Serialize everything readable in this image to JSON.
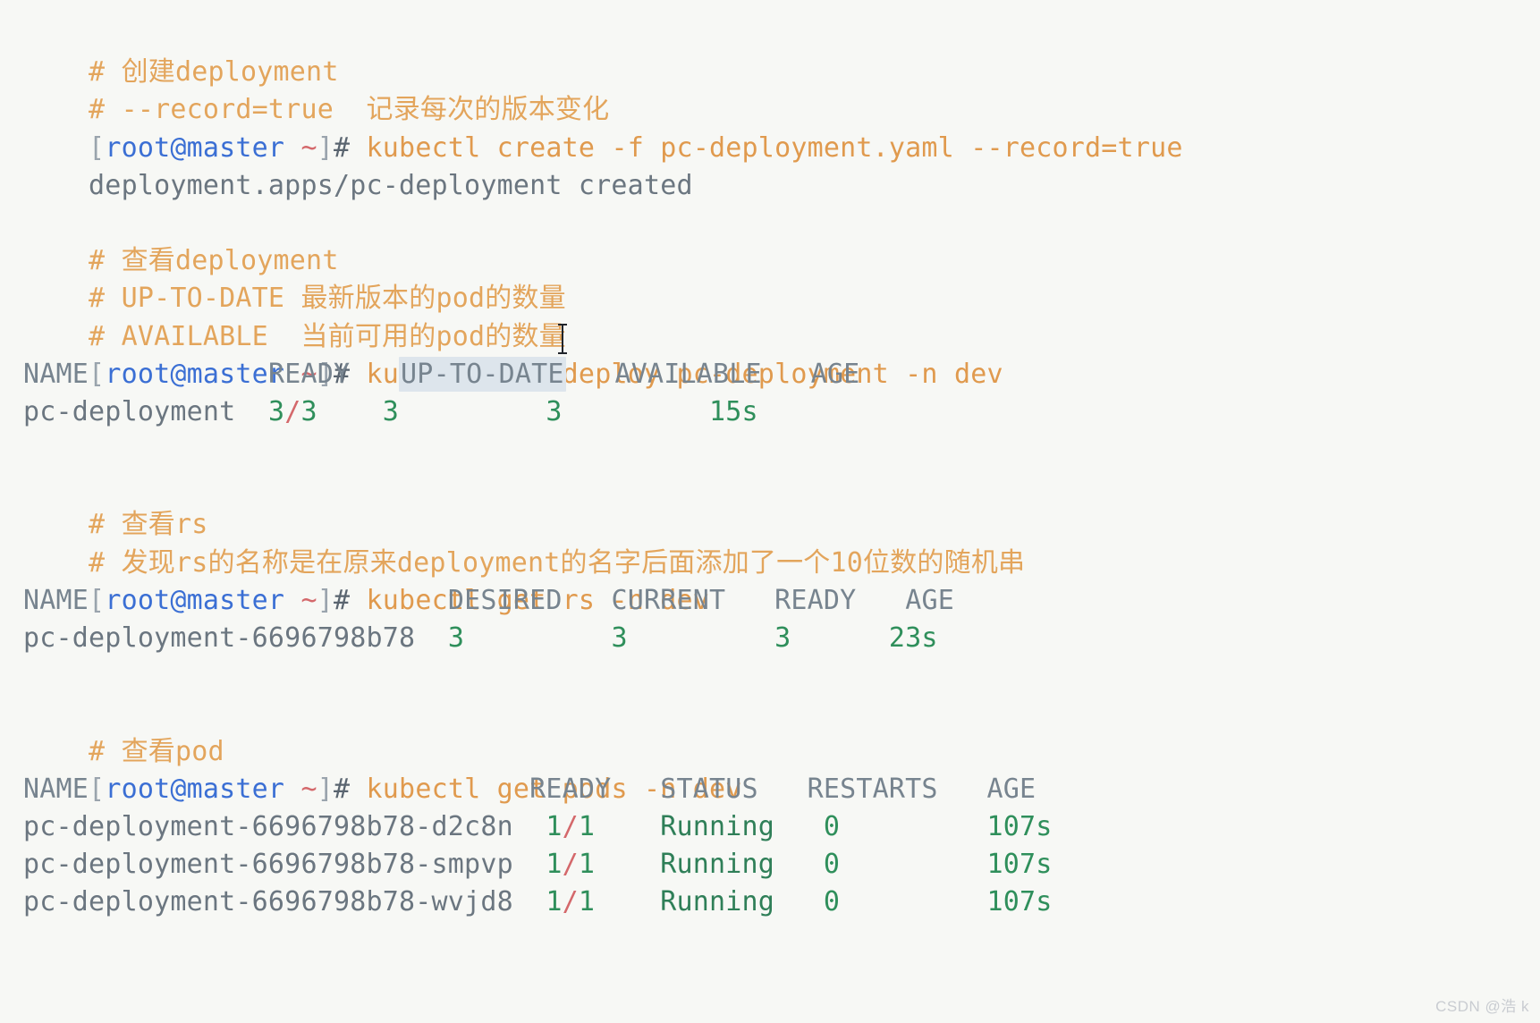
{
  "terminal": {
    "background_color": "#f7f8f5",
    "colors": {
      "comment": "#e3a55c",
      "command": "#e09a4e",
      "output": "#6b7680",
      "header": "#77848f",
      "number": "#2f8f5b",
      "prompt_user": "#3b6fd4",
      "prompt_tilde": "#d4686b",
      "highlight": "#dde5ec"
    },
    "prompt": {
      "open_bracket": "[",
      "user_host": "root@master",
      "space_tilde": " ~",
      "close_bracket": "]",
      "hash": "# "
    },
    "blocks": [
      {
        "id": "create-deployment",
        "comments": [
          "# 创建deployment",
          "# --record=true  记录每次的版本变化"
        ],
        "command": "kubectl create -f pc-deployment.yaml --record=true",
        "output": [
          "deployment.apps/pc-deployment created"
        ]
      },
      {
        "id": "get-deployment",
        "comments": [
          "# 查看deployment",
          "# UP-TO-DATE 最新版本的pod的数量",
          "# AVAILABLE  当前可用的pod的数量"
        ],
        "command": "kubectl get deploy pc-deployment -n dev",
        "table": {
          "headers": [
            "NAME",
            "READY",
            "UP-TO-DATE",
            "AVAILABLE",
            "AGE"
          ],
          "highlighted_header": "UP-TO-DATE",
          "rows": [
            {
              "name": "pc-deployment",
              "ready": "3/3",
              "up_to_date": "3",
              "available": "3",
              "age": "15s"
            }
          ]
        }
      },
      {
        "id": "get-rs",
        "comments": [
          "# 查看rs",
          "# 发现rs的名称是在原来deployment的名字后面添加了一个10位数的随机串"
        ],
        "command": "kubectl get rs -n dev",
        "table": {
          "headers": [
            "NAME",
            "DESIRED",
            "CURRENT",
            "READY",
            "AGE"
          ],
          "rows": [
            {
              "name": "pc-deployment-6696798b78",
              "desired": "3",
              "current": "3",
              "ready": "3",
              "age": "23s"
            }
          ]
        }
      },
      {
        "id": "get-pods",
        "comments": [
          "# 查看pod"
        ],
        "command": "kubectl get pods -n dev",
        "table": {
          "headers": [
            "NAME",
            "READY",
            "STATUS",
            "RESTARTS",
            "AGE"
          ],
          "rows": [
            {
              "name": "pc-deployment-6696798b78-d2c8n",
              "ready": "1/1",
              "status": "Running",
              "restarts": "0",
              "age": "107s"
            },
            {
              "name": "pc-deployment-6696798b78-smpvp",
              "ready": "1/1",
              "status": "Running",
              "restarts": "0",
              "age": "107s"
            },
            {
              "name": "pc-deployment-6696798b78-wvjd8",
              "ready": "1/1",
              "status": "Running",
              "restarts": "0",
              "age": "107s"
            }
          ]
        }
      }
    ]
  },
  "watermark": "CSDN @浩 k"
}
